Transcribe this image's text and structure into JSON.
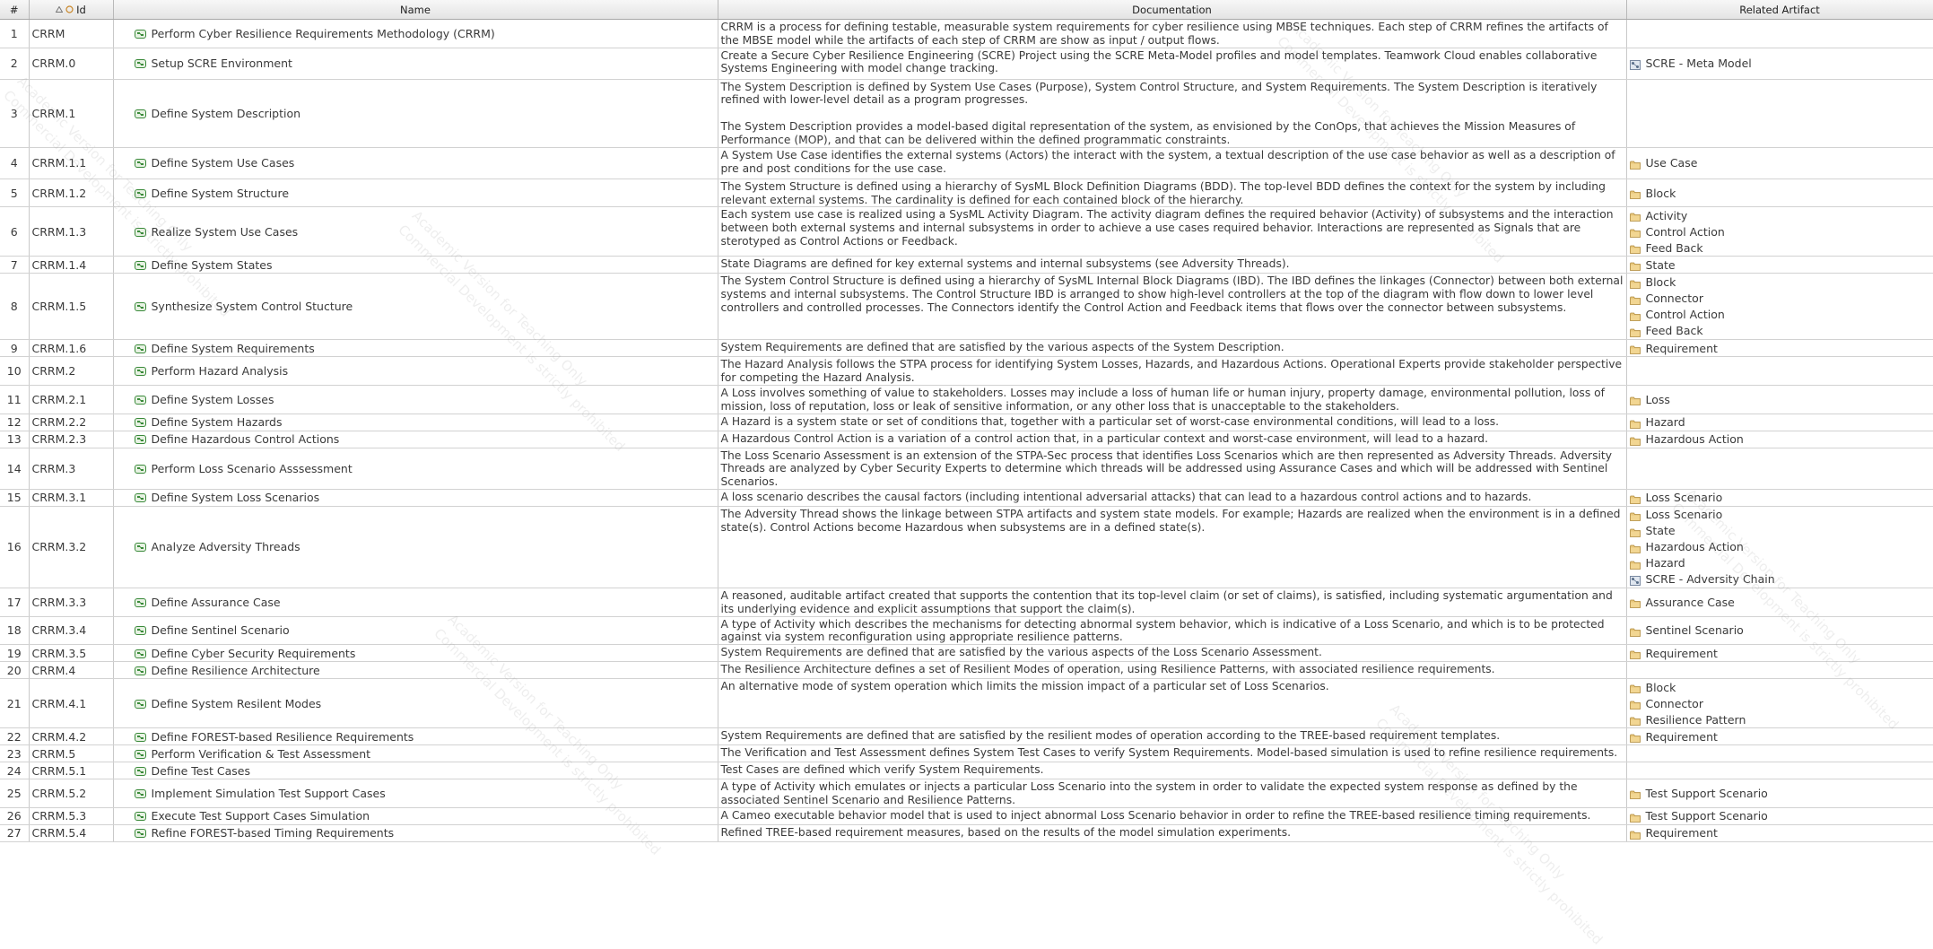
{
  "columns": {
    "num": "#",
    "id": "Id",
    "name": "Name",
    "doc": "Documentation",
    "art": "Related Artifact"
  },
  "watermark": {
    "line1": "Academic Version for Teaching Only",
    "line2": "Commercial Development is strictly prohibited"
  },
  "colors": {
    "header_bg": "#e9e9e9",
    "grid_line": "#c9c9c9",
    "activity_icon": "#3a8a3a",
    "artifact_icon": "#c8a050"
  },
  "rows": [
    {
      "num": "1",
      "id": "CRRM",
      "name": "Perform Cyber Resilience Requirements Methodology (CRRM)",
      "doc": [
        "CRRM is a process for defining testable, measurable system requirements for cyber resilience using MBSE techniques.  Each step of CRRM refines the artifacts of the MBSE model while the artifacts of each step of CRRM are show as input / output flows."
      ],
      "art": []
    },
    {
      "num": "2",
      "id": "CRRM.0",
      "name": "Setup SCRE Environment",
      "doc": [
        "Create a Secure Cyber Resilience Engineering (SCRE) Project using the SCRE Meta-Model profiles and model templates.  Teamwork Cloud enables collaborative Systems Engineering with model change tracking."
      ],
      "art": [
        {
          "label": "SCRE - Meta Model",
          "icon": "model-icon"
        }
      ]
    },
    {
      "num": "3",
      "id": "CRRM.1",
      "name": "Define System Description",
      "doc": [
        "The System  Description is defined by System Use Cases (Purpose), System Control Structure, and System Requirements. The System Description is iteratively refined with lower-level detail as a program progresses.",
        "The System Description provides a model-based digital representation of the system, as envisioned by the ConOps, that achieves the Mission Measures of Performance (MOP), and that can be delivered within the defined programmatic constraints."
      ],
      "art": []
    },
    {
      "num": "4",
      "id": "CRRM.1.1",
      "name": "Define System Use Cases",
      "doc": [
        "A System Use Case identifies the external systems (Actors) the interact with the system, a textual description of the use case behavior as well as a description of pre and post conditions for the use case."
      ],
      "art": [
        {
          "label": "Use Case",
          "icon": "folder-icon"
        }
      ]
    },
    {
      "num": "5",
      "id": "CRRM.1.2",
      "name": "Define System Structure",
      "doc": [
        "The System Structure is defined using a hierarchy of SysML Block Definition Diagrams (BDD). The top-level BDD defines the context for the system by including relevant external systems. The cardinality is defined for each contained block of the hierarchy."
      ],
      "art": [
        {
          "label": "Block",
          "icon": "folder-icon"
        }
      ]
    },
    {
      "num": "6",
      "id": "CRRM.1.3",
      "name": "Realize System Use Cases",
      "doc": [
        "Each system use case is realized using a SysML Activity Diagram.  The activity diagram defines the required  behavior (Activity) of subsystems and the interaction between both external systems and internal subsystems in order to achieve a use cases required behavior.  Interactions are represented as Signals that are sterotyped as Control Actions or Feedback."
      ],
      "art": [
        {
          "label": "Activity",
          "icon": "folder-icon"
        },
        {
          "label": "Control Action",
          "icon": "folder-icon"
        },
        {
          "label": "Feed Back",
          "icon": "folder-icon"
        }
      ]
    },
    {
      "num": "7",
      "id": "CRRM.1.4",
      "name": "Define System States",
      "doc": [
        "State Diagrams are defined for key external systems and internal subsystems (see Adversity Threads)."
      ],
      "art": [
        {
          "label": "State",
          "icon": "folder-icon"
        }
      ]
    },
    {
      "num": "8",
      "id": "CRRM.1.5",
      "name": "Synthesize System Control Stucture",
      "doc": [
        "The System Control Structure is defined using a hierarchy of SysML Internal Block Diagrams (IBD). The IBD defines the linkages (Connector) between both external systems and internal subsystems.  The Control Structure IBD is arranged to show high-level controllers at the top of the diagram with flow down to lower level controllers and controlled processes. The Connectors identify the Control Action and Feedback items that flows over the connector between subsystems."
      ],
      "art": [
        {
          "label": "Block",
          "icon": "folder-icon"
        },
        {
          "label": "Connector",
          "icon": "folder-icon"
        },
        {
          "label": "Control Action",
          "icon": "folder-icon"
        },
        {
          "label": "Feed Back",
          "icon": "folder-icon"
        }
      ]
    },
    {
      "num": "9",
      "id": "CRRM.1.6",
      "name": "Define System Requirements",
      "doc": [
        "System Requirements are defined that are satisfied by the various aspects of the System Description."
      ],
      "art": [
        {
          "label": "Requirement",
          "icon": "folder-icon"
        }
      ]
    },
    {
      "num": "10",
      "id": "CRRM.2",
      "name": "Perform Hazard Analysis",
      "doc": [
        "The Hazard Analysis follows the STPA process for identifying System Losses, Hazards, and Hazardous Actions. Operational Experts provide stakeholder perspective for competing the Hazard Analysis."
      ],
      "art": []
    },
    {
      "num": "11",
      "id": "CRRM.2.1",
      "name": "Define System Losses",
      "doc": [
        "A Loss involves something of value to stakeholders. Losses may include a loss of human life or human injury, property damage, environmental pollution, loss of mission, loss of reputation, loss or leak of sensitive information, or any other loss that is unacceptable to the stakeholders."
      ],
      "art": [
        {
          "label": "Loss",
          "icon": "folder-icon"
        }
      ]
    },
    {
      "num": "12",
      "id": "CRRM.2.2",
      "name": "Define System Hazards",
      "doc": [
        "A Hazard is a system state or set of conditions that, together with a particular set of worst-case environmental conditions, will lead to a loss."
      ],
      "art": [
        {
          "label": "Hazard",
          "icon": "folder-icon"
        }
      ]
    },
    {
      "num": "13",
      "id": "CRRM.2.3",
      "name": "Define Hazardous Control Actions",
      "doc": [
        "A Hazardous Control Action is a variation of a control action that, in a particular context and worst-case environment, will lead to a hazard."
      ],
      "art": [
        {
          "label": "Hazardous Action",
          "icon": "folder-icon"
        }
      ]
    },
    {
      "num": "14",
      "id": "CRRM.3",
      "name": "Perform Loss Scenario Asssessment",
      "doc": [
        "The Loss Scenario Assessment is an extension of the STPA-Sec process that identifies Loss Scenarios which are then represented as Adversity Threads.  Adversity Threads are analyzed by Cyber Security Experts to determine which threads will be addressed using Assurance Cases and which will be addressed with Sentinel Scenarios."
      ],
      "art": []
    },
    {
      "num": "15",
      "id": "CRRM.3.1",
      "name": "Define System Loss Scenarios",
      "doc": [
        "A loss scenario describes the causal factors (including intentional adversarial attacks) that can lead to a hazardous control actions and to hazards."
      ],
      "art": [
        {
          "label": "Loss Scenario",
          "icon": "folder-icon"
        }
      ]
    },
    {
      "num": "16",
      "id": "CRRM.3.2",
      "name": "Analyze Adversity Threads",
      "doc": [
        "The Adversity Thread shows the linkage between STPA artifacts and system state models. For example;  Hazards are realized when the environment is in a defined state(s). Control Actions become Hazardous when subsystems are in a defined state(s)."
      ],
      "art": [
        {
          "label": "Loss Scenario",
          "icon": "folder-icon"
        },
        {
          "label": "State",
          "icon": "folder-icon"
        },
        {
          "label": "Hazardous Action",
          "icon": "folder-icon"
        },
        {
          "label": "Hazard",
          "icon": "folder-icon"
        },
        {
          "label": "SCRE - Adversity Chain",
          "icon": "model-icon"
        }
      ]
    },
    {
      "num": "17",
      "id": "CRRM.3.3",
      "name": "Define Assurance Case",
      "doc": [
        "A reasoned, auditable artifact created that supports the contention that its top-level claim (or set of claims), is satisfied, including systematic argumentation and its underlying evidence and explicit assumptions that support the claim(s)."
      ],
      "art": [
        {
          "label": "Assurance Case",
          "icon": "folder-icon"
        }
      ]
    },
    {
      "num": "18",
      "id": "CRRM.3.4",
      "name": "Define Sentinel Scenario",
      "doc": [
        "A type of Activity which describes the mechanisms for detecting abnormal system behavior, which is indicative of a Loss Scenario, and which is to be protected against via system reconfiguration using appropriate resilience patterns."
      ],
      "art": [
        {
          "label": "Sentinel Scenario",
          "icon": "folder-icon"
        }
      ]
    },
    {
      "num": "19",
      "id": "CRRM.3.5",
      "name": "Define Cyber Security Requirements",
      "doc": [
        "System Requirements are defined that are satisfied by the various aspects of the Loss Scenario Assessment."
      ],
      "art": [
        {
          "label": "Requirement",
          "icon": "folder-icon"
        }
      ]
    },
    {
      "num": "20",
      "id": "CRRM.4",
      "name": "Define Resilience Architecture",
      "doc": [
        "The Resilience Architecture defines a set of Resilient Modes of operation, using Resilience Patterns, with associated resilience requirements."
      ],
      "art": []
    },
    {
      "num": "21",
      "id": "CRRM.4.1",
      "name": "Define System Resilent Modes",
      "doc": [
        "An alternative mode of system operation which limits the mission impact of a particular set of Loss Scenarios."
      ],
      "art": [
        {
          "label": "Block",
          "icon": "folder-icon"
        },
        {
          "label": "Connector",
          "icon": "folder-icon"
        },
        {
          "label": "Resilience Pattern",
          "icon": "folder-icon"
        }
      ]
    },
    {
      "num": "22",
      "id": "CRRM.4.2",
      "name": "Define FOREST-based Resilience Requirements",
      "doc": [
        "System Requirements are defined that are satisfied by the resilient modes of operation according to the TREE-based requirement templates."
      ],
      "art": [
        {
          "label": "Requirement",
          "icon": "folder-icon"
        }
      ]
    },
    {
      "num": "23",
      "id": "CRRM.5",
      "name": "Perform Verification & Test Assessment",
      "doc": [
        "The Verification and Test Assessment defines System Test Cases to verify System Requirements. Model-based simulation is used to refine resilience requirements."
      ],
      "art": []
    },
    {
      "num": "24",
      "id": "CRRM.5.1",
      "name": "Define Test Cases",
      "doc": [
        "Test Cases are defined which verify System Requirements."
      ],
      "art": []
    },
    {
      "num": "25",
      "id": "CRRM.5.2",
      "name": "Implement Simulation Test Support Cases",
      "doc": [
        "A type of Activity which emulates or injects a particular Loss Scenario into the system in order to validate the expected system response as defined by the associated Sentinel Scenario and Resilience Patterns."
      ],
      "art": [
        {
          "label": "Test Support Scenario",
          "icon": "folder-icon"
        }
      ]
    },
    {
      "num": "26",
      "id": "CRRM.5.3",
      "name": "Execute Test Support Cases Simulation",
      "doc": [
        "A Cameo executable behavior model that is used to inject abnormal Loss Scenario behavior in order to refine the TREE-based resilience timing requirements."
      ],
      "art": [
        {
          "label": "Test Support Scenario",
          "icon": "folder-icon"
        }
      ]
    },
    {
      "num": "27",
      "id": "CRRM.5.4",
      "name": "Refine FOREST-based Timing Requirements",
      "doc": [
        "Refined TREE-based requirement measures, based on the results of the model simulation experiments."
      ],
      "art": [
        {
          "label": "Requirement",
          "icon": "folder-icon"
        }
      ]
    }
  ]
}
